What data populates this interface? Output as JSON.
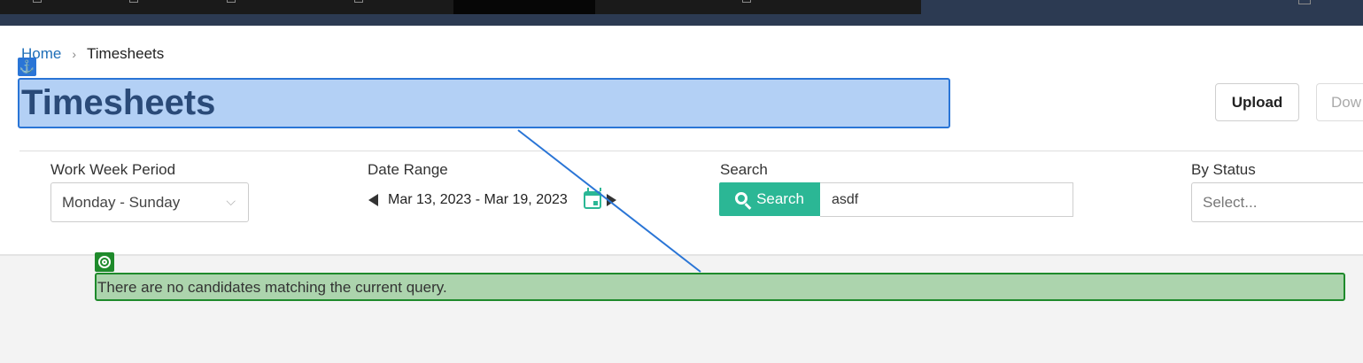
{
  "breadcrumb": {
    "home": "Home",
    "current": "Timesheets"
  },
  "page": {
    "title": "Timesheets"
  },
  "actions": {
    "upload": "Upload",
    "download": "Dow"
  },
  "filters": {
    "work_week": {
      "label": "Work Week Period",
      "value": "Monday - Sunday"
    },
    "date_range": {
      "label": "Date Range",
      "value": "Mar 13, 2023 - Mar 19, 2023"
    },
    "search": {
      "label": "Search",
      "button": "Search",
      "value": "asdf"
    },
    "status": {
      "label": "By Status",
      "placeholder": "Select..."
    }
  },
  "results": {
    "empty_message": "There are no candidates matching the current query."
  },
  "colors": {
    "accent": "#2bb795",
    "link": "#1f6fb8",
    "topbar": "#2c3a52",
    "highlight_blue": "#2a75d6",
    "highlight_green": "#1e8a2b"
  },
  "icons": {
    "anchor": "anchor-icon",
    "target": "target-icon",
    "calendar": "calendar-icon",
    "search": "search-icon"
  }
}
